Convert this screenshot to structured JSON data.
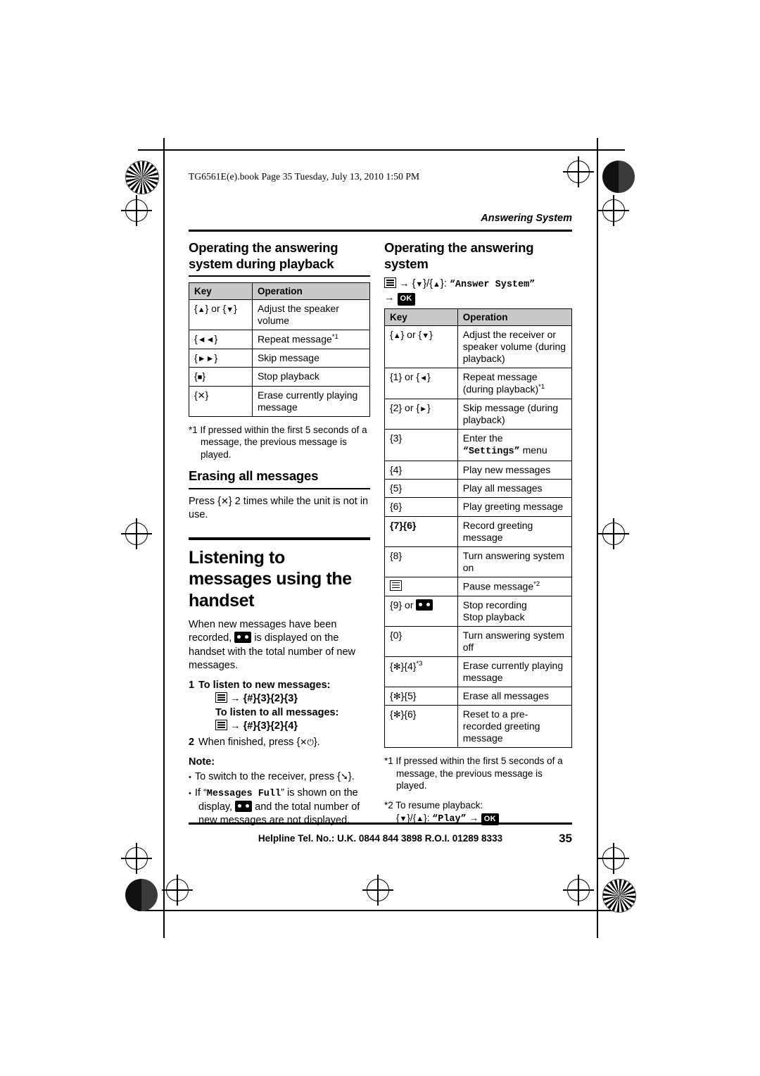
{
  "page": {
    "file_header": "TG6561E(e).book  Page 35  Tuesday, July 13, 2010  1:50 PM",
    "chapter": "Answering System",
    "footer": "Helpline Tel. No.: U.K. 0844 844 3898 R.O.I. 01289 8333",
    "page_number": "35"
  },
  "left": {
    "section1_title": "Operating the answering system during playback",
    "table1": {
      "headers": [
        "Key",
        "Operation"
      ],
      "rows": [
        {
          "key": "{▲} or {▼}",
          "op": "Adjust the speaker volume"
        },
        {
          "key": "{⏪}",
          "op": "Repeat message*1"
        },
        {
          "key": "{⏩}",
          "op": "Skip message"
        },
        {
          "key": "{■}",
          "op": "Stop playback"
        },
        {
          "key": "{✕}",
          "op": "Erase currently playing message"
        }
      ]
    },
    "footnote1": "*1 If pressed within the first 5 seconds of a message, the previous message is played.",
    "section2_title": "Erasing all messages",
    "section2_body_pre": "Press ",
    "section2_body_key": "{✕}",
    "section2_body_post": " 2 times while the unit is not in use.",
    "big_title": "Listening to messages using the handset",
    "intro_part1": "When new messages have been recorded, ",
    "intro_part2": " is displayed on the handset with the total number of new messages.",
    "step1_label": "To listen to new messages:",
    "step1_keys": "{#}{3}{2}{3}",
    "step1_label2": "To listen to all messages:",
    "step1_keys2": "{#}{3}{2}{4}",
    "step2_text": "When finished, press ",
    "step2_key": "{✕⏻}",
    "note_label": "Note:",
    "note1_pre": "To switch to the receiver, press ",
    "note1_key": "{☎}",
    "note1_post": ".",
    "note2_pre": "If “",
    "note2_mono": "Messages Full",
    "note2_mid": "” is shown on the display, ",
    "note2_post": " and the total number of new messages are not displayed."
  },
  "right": {
    "section_title": "Operating the answering system",
    "nav_line_1": "/",
    "nav_answer_system": "“Answer System”",
    "nav_ok": "OK",
    "table": {
      "headers": [
        "Key",
        "Operation"
      ],
      "rows": [
        {
          "key": "{▲} or {▼}",
          "op": "Adjust the receiver or speaker volume (during playback)"
        },
        {
          "key": "{1} or {◀}",
          "op": "Repeat message (during playback)*1"
        },
        {
          "key": "{2} or {▶}",
          "op": "Skip message (during playback)"
        },
        {
          "key": "{3}",
          "op": "Enter the “Settings” menu",
          "op_mono": "Settings"
        },
        {
          "key": "{4}",
          "op": "Play new messages"
        },
        {
          "key": "{5}",
          "op": "Play all messages"
        },
        {
          "key": "{6}",
          "op": "Play greeting message"
        },
        {
          "key": "{7}{6}",
          "op": "Record greeting message"
        },
        {
          "key": "{8}",
          "op": "Turn answering system on"
        },
        {
          "key": "PAUSE-ICON",
          "op": "Pause message*2"
        },
        {
          "key": "{9} or STOP-ICON",
          "op": "Stop recording\nStop playback"
        },
        {
          "key": "{0}",
          "op": "Turn answering system off"
        },
        {
          "key": "{∗}{4}*3",
          "op": "Erase currently playing message"
        },
        {
          "key": "{∗}{5}",
          "op": "Erase all messages"
        },
        {
          "key": "{∗}{6}",
          "op": "Reset to a pre-recorded greeting message"
        }
      ]
    },
    "footnote1": "*1 If pressed within the first 5 seconds of a message, the previous message is played.",
    "footnote2_label": "*2 To resume playback:",
    "footnote2_keys": "/",
    "footnote2_play": "“Play”",
    "footnote2_ok": "OK"
  }
}
